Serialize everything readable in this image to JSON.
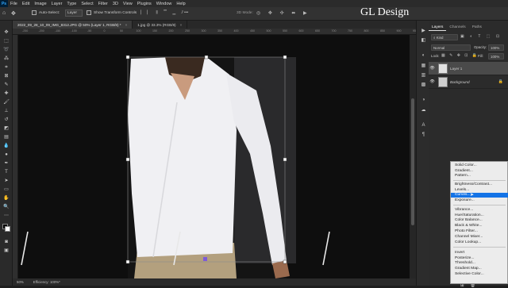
{
  "menubar": {
    "app_logo": "Ps",
    "items": [
      "File",
      "Edit",
      "Image",
      "Layer",
      "Type",
      "Select",
      "Filter",
      "3D",
      "View",
      "Plugins",
      "Window",
      "Help"
    ]
  },
  "watermark": "GL Design",
  "options": {
    "auto_select_label": "Auto-Select:",
    "auto_select_value": "Layer",
    "show_transform_label": "Show Transform Controls",
    "mode_3d_label": "3D Mode:"
  },
  "document_tabs": [
    {
      "label": "2022_09_28_10_09_IMG_8312.JPG @ 50% (Layer 1, RGB/8) *",
      "close": "×"
    },
    {
      "label": "1.jpg @ 33.3% (RGB/8)",
      "close": "×"
    }
  ],
  "ruler_marks": [
    "-250",
    "-200",
    "-150",
    "-100",
    "-50",
    "0",
    "50",
    "100",
    "150",
    "200",
    "250",
    "300",
    "350",
    "400",
    "450",
    "500",
    "550",
    "600",
    "650",
    "700",
    "750",
    "800",
    "850",
    "900",
    "950"
  ],
  "status": {
    "zoom": "50%",
    "info": "Efficiency: 100%*"
  },
  "layers_panel": {
    "tabs": [
      "Layers",
      "Channels",
      "Paths"
    ],
    "filter_kind": "Kind",
    "blend_mode": "Normal",
    "opacity_label": "Opacity:",
    "opacity_value": "100%",
    "lock_label": "Lock:",
    "fill_label": "Fill:",
    "fill_value": "100%",
    "layers": [
      {
        "name": "Layer 1",
        "visible": true,
        "selected": true
      },
      {
        "name": "Background",
        "visible": true,
        "selected": false
      }
    ]
  },
  "adjustment_menu": {
    "groups": [
      [
        "Solid Color...",
        "Gradient...",
        "Pattern..."
      ],
      [
        "Brightness/Contrast...",
        "Levels...",
        "Curves...",
        "Exposure..."
      ],
      [
        "Vibrance...",
        "Hue/Saturation...",
        "Color Balance...",
        "Black & White...",
        "Photo Filter...",
        "Channel Mixer...",
        "Color Lookup..."
      ],
      [
        "Invert",
        "Posterize...",
        "Threshold...",
        "Gradient Map...",
        "Selective Color..."
      ]
    ],
    "highlighted": "Curves..."
  },
  "colors": {
    "highlight": "#1473e6",
    "canvas_bg": "#0e0e0e",
    "shirt": "#f2f2f4",
    "pants": "#b3a07e"
  }
}
